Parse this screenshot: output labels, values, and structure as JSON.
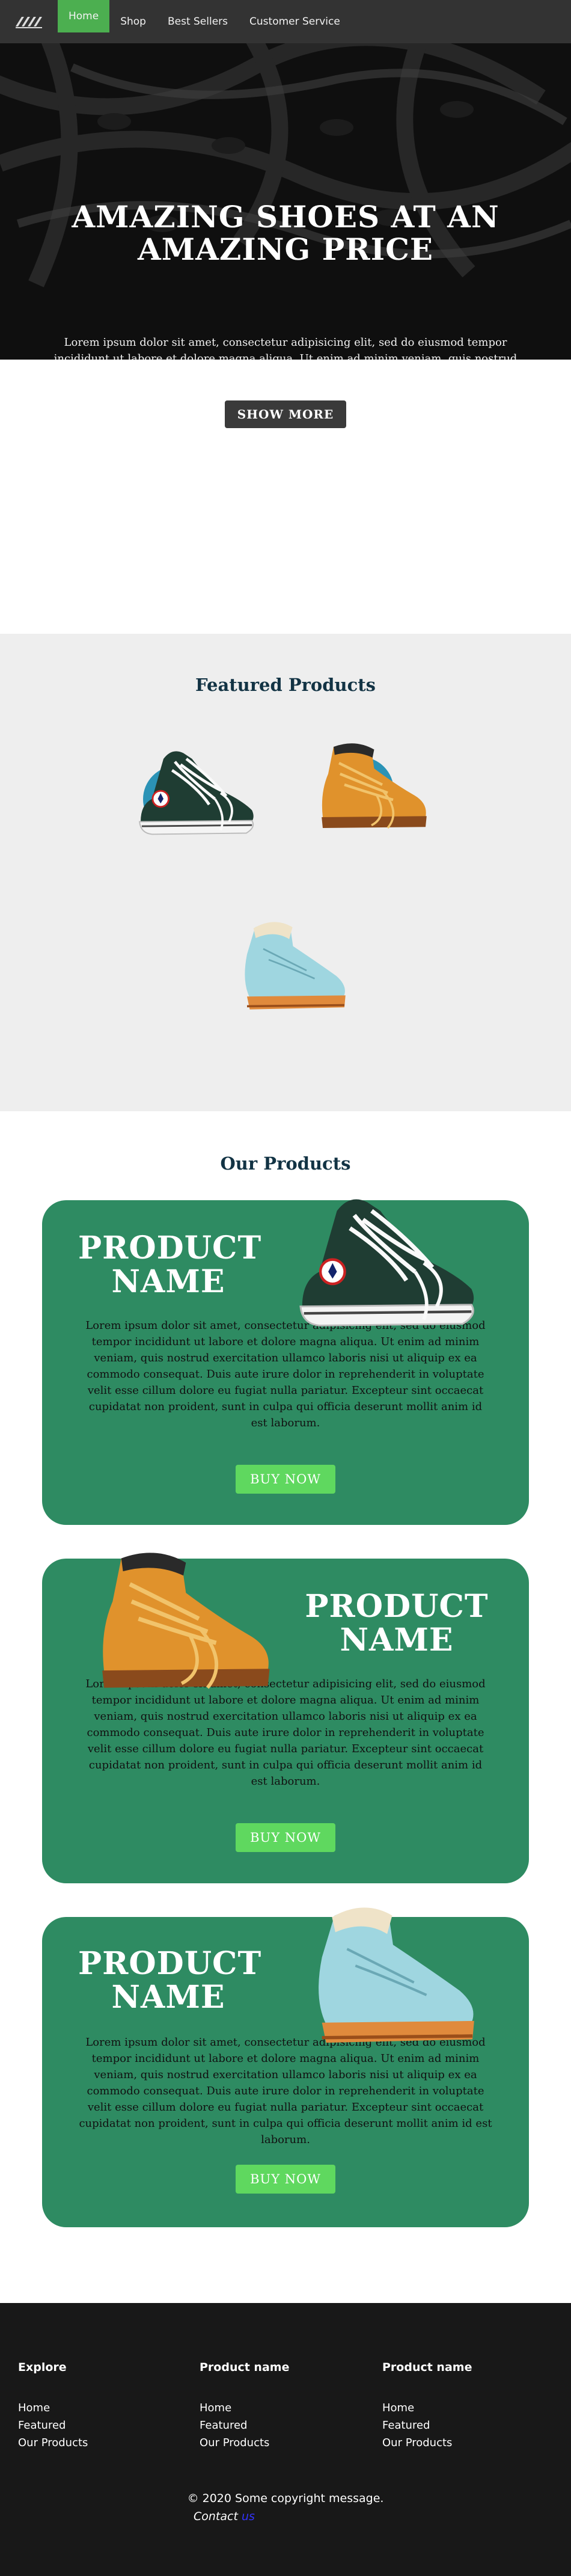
{
  "nav": {
    "logo_icon": "shoe-brand-logo",
    "items": [
      "Home",
      "Shop",
      "Best Sellers",
      "Customer Service"
    ],
    "active_color": "#4caf50"
  },
  "hero": {
    "title": "AMAZING SHOES AT AN AMAZING PRICE",
    "text": "Lorem ipsum dolor sit amet, consectetur adipisicing elit, sed do eiusmod tempor incididunt ut labore et dolore magna aliqua. Ut enim ad minim veniam, quis nostrud exercitation ullamco laboris nisi ut aliquip ex ea commodo consequat. Duis aute irure dolor in reprehenderit in voluptate velit esse cillum dolore eu fugiat nulla pariatur.",
    "button": "SHOW MORE"
  },
  "featured": {
    "title": "Featured Products"
  },
  "products": {
    "title": "Our Products",
    "card_color": "#2e8b62",
    "button_color": "#5fd85f",
    "items": [
      {
        "name": "PRODUCT NAME",
        "text": "Lorem ipsum dolor sit amet, consectetur adipisicing elit, sed do eiusmod tempor incididunt ut labore et dolore magna aliqua. Ut enim ad minim veniam, quis nostrud exercitation ullamco laboris nisi ut aliquip ex ea commodo consequat. Duis aute irure dolor in reprehenderit in voluptate velit esse cillum dolore eu fugiat nulla pariatur. Excepteur sint occaecat cupidatat non proident, sunt in culpa qui officia deserunt mollit anim id est laborum.",
        "button": "BUY NOW"
      },
      {
        "name": "PRODUCT NAME",
        "text": "Lorem ipsum dolor sit amet, consectetur adipisicing elit, sed do eiusmod tempor incididunt ut labore et dolore magna aliqua. Ut enim ad minim veniam, quis nostrud exercitation ullamco laboris nisi ut aliquip ex ea commodo consequat. Duis aute irure dolor in reprehenderit in voluptate velit esse cillum dolore eu fugiat nulla pariatur. Excepteur sint occaecat cupidatat non proident, sunt in culpa qui officia deserunt mollit anim id est laborum.",
        "button": "BUY NOW"
      },
      {
        "name": "PRODUCT NAME",
        "text": "Lorem ipsum dolor sit amet, consectetur adipisicing elit, sed do eiusmod tempor incididunt ut labore et dolore magna aliqua. Ut enim ad minim veniam, quis nostrud exercitation ullamco laboris nisi ut aliquip ex ea commodo consequat. Duis aute irure dolor in reprehenderit in voluptate velit esse cillum dolore eu fugiat nulla pariatur. Excepteur sint occaecat cupidatat non proident, sunt in culpa qui officia deserunt mollit anim id est laborum.",
        "button": "BUY NOW"
      }
    ]
  },
  "footer": {
    "columns": [
      {
        "heading": "Explore",
        "links": [
          "Home",
          "Featured",
          "Our Products"
        ]
      },
      {
        "heading": "Product name",
        "links": [
          "Home",
          "Featured",
          "Our Products"
        ]
      },
      {
        "heading": "Product name",
        "links": [
          "Home",
          "Featured",
          "Our Products"
        ]
      }
    ],
    "copyright": "© 2020 Some copyright message.",
    "contact_label": "Contact",
    "contact_link": "us"
  }
}
